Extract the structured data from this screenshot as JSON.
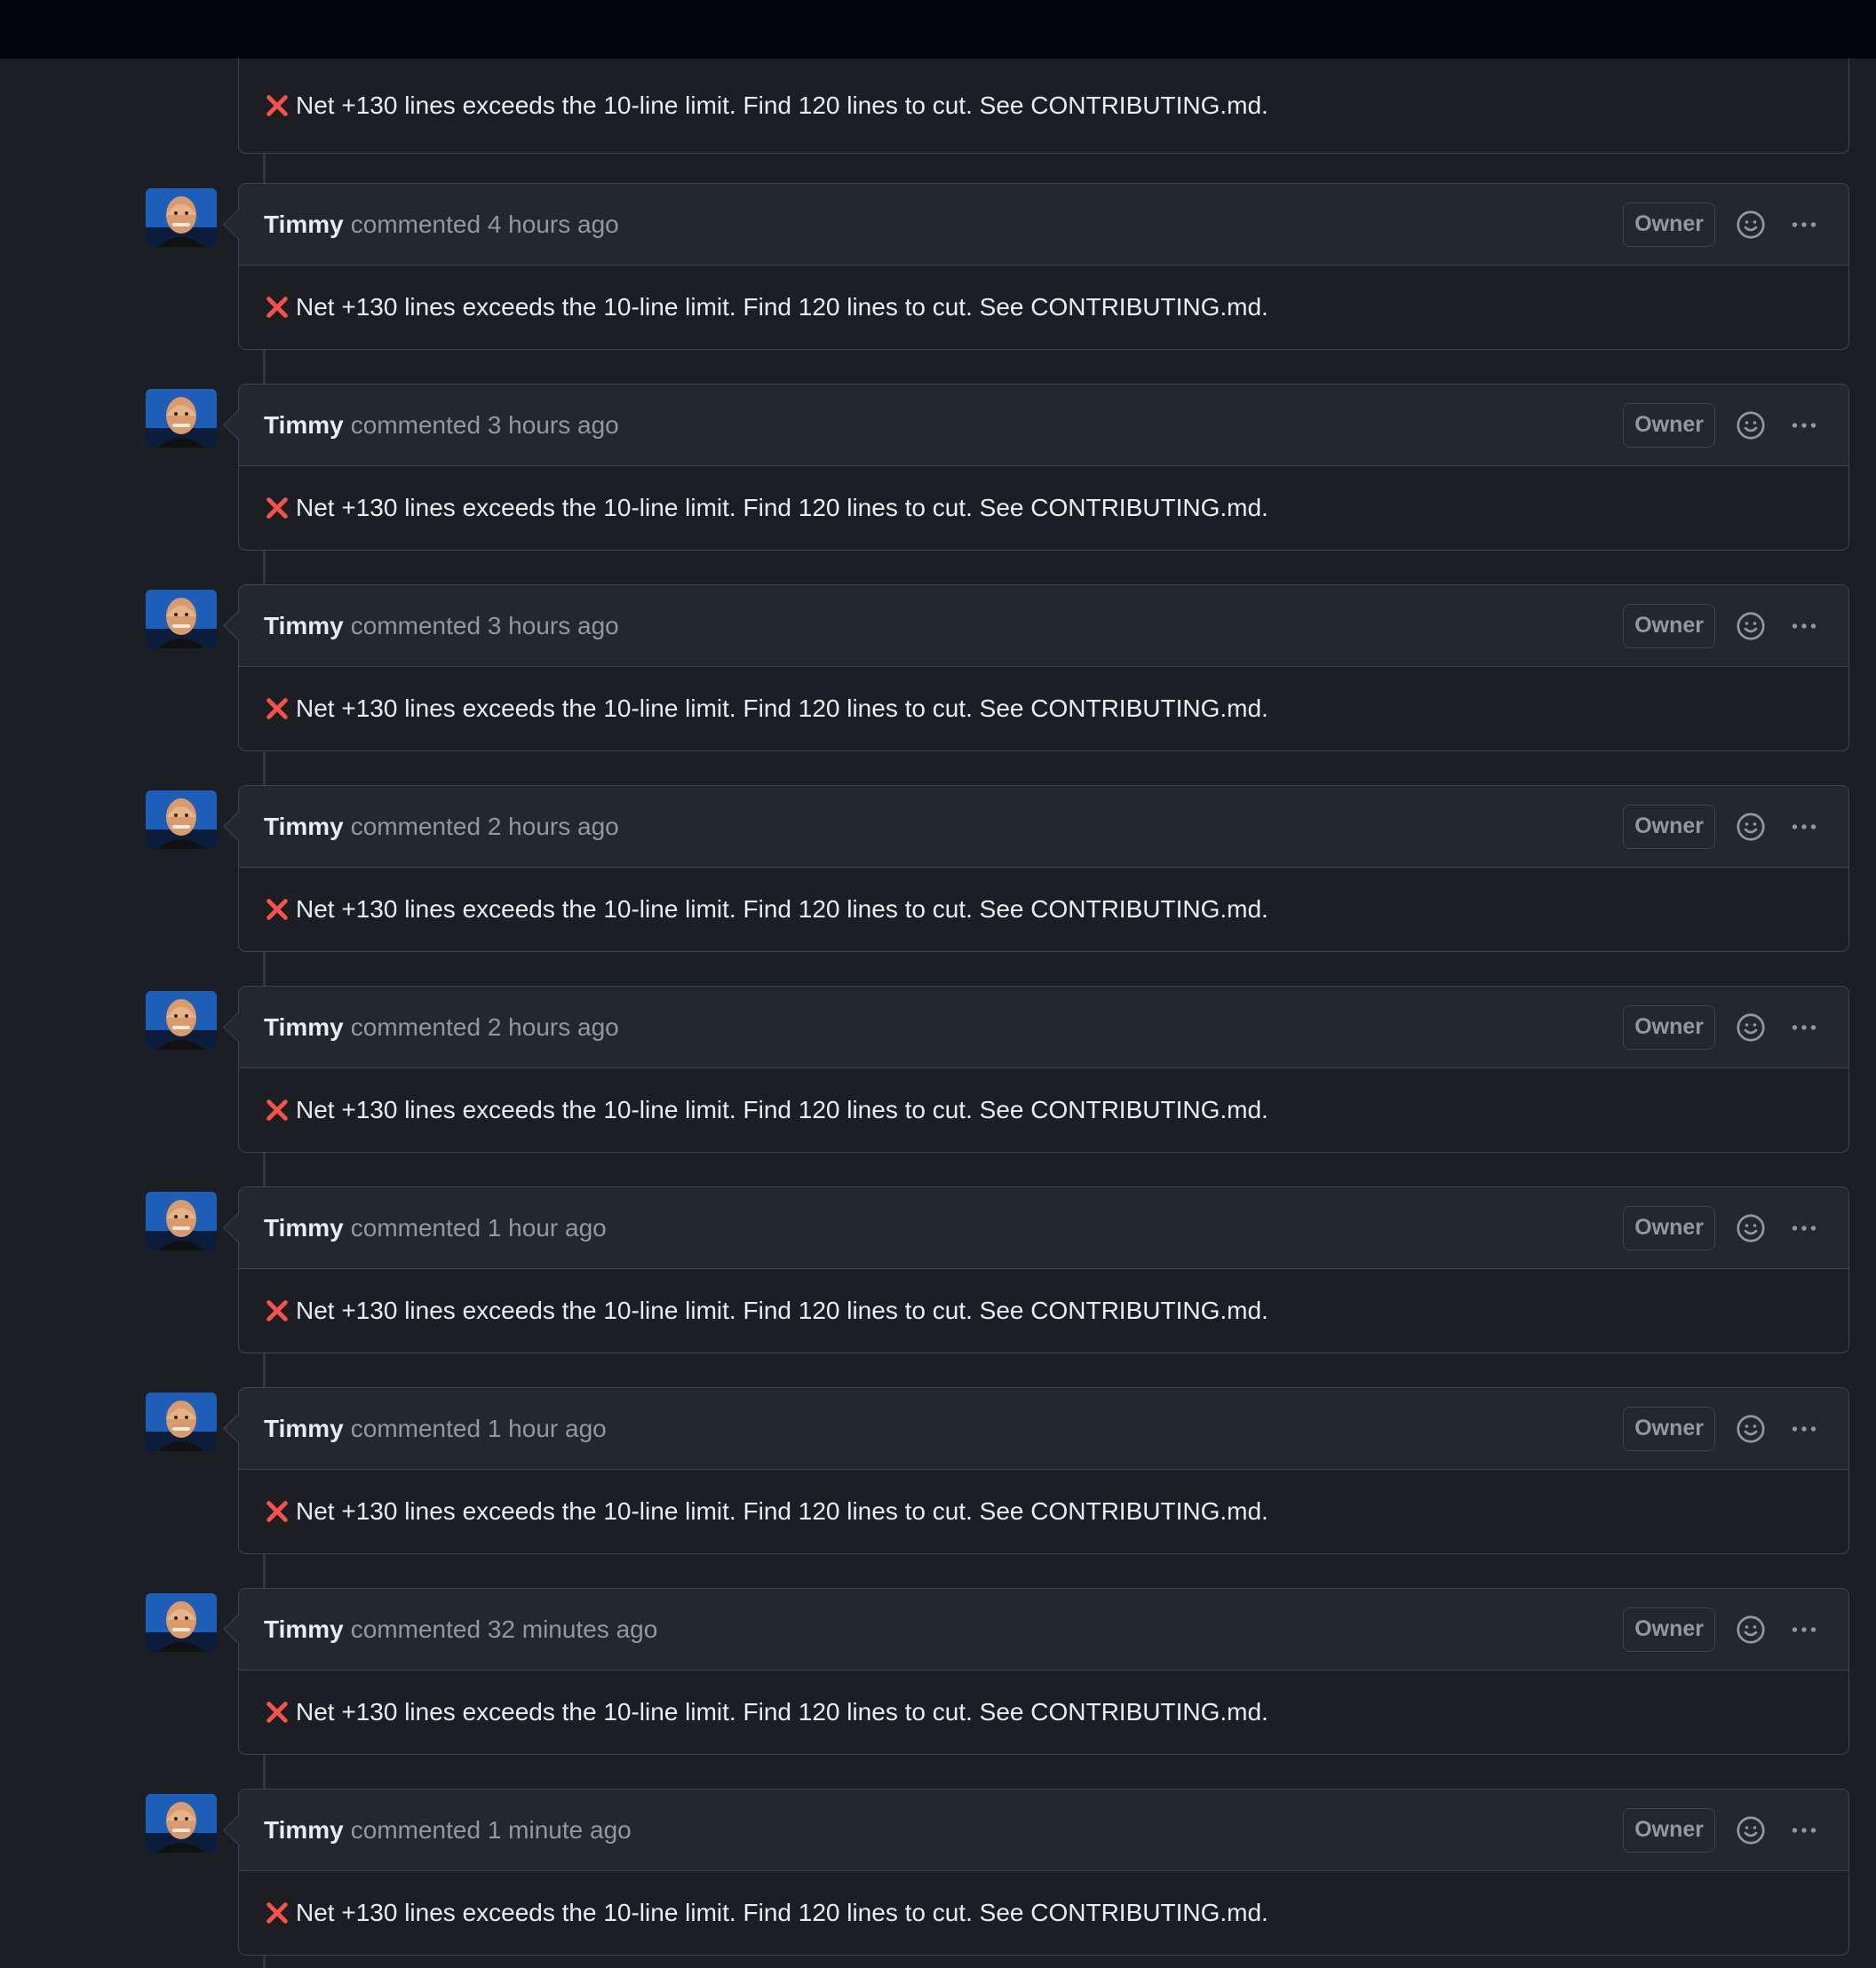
{
  "comments": [
    {
      "author": "",
      "verb": "",
      "time": "",
      "badge": "",
      "body": "Net +130 lines exceeds the 10-line limit. Find 120 lines to cut. See CONTRIBUTING.md."
    },
    {
      "author": "Timmy",
      "verb": "commented",
      "time": "4 hours ago",
      "badge": "Owner",
      "body": "Net +130 lines exceeds the 10-line limit. Find 120 lines to cut. See CONTRIBUTING.md."
    },
    {
      "author": "Timmy",
      "verb": "commented",
      "time": "3 hours ago",
      "badge": "Owner",
      "body": "Net +130 lines exceeds the 10-line limit. Find 120 lines to cut. See CONTRIBUTING.md."
    },
    {
      "author": "Timmy",
      "verb": "commented",
      "time": "3 hours ago",
      "badge": "Owner",
      "body": "Net +130 lines exceeds the 10-line limit. Find 120 lines to cut. See CONTRIBUTING.md."
    },
    {
      "author": "Timmy",
      "verb": "commented",
      "time": "2 hours ago",
      "badge": "Owner",
      "body": "Net +130 lines exceeds the 10-line limit. Find 120 lines to cut. See CONTRIBUTING.md."
    },
    {
      "author": "Timmy",
      "verb": "commented",
      "time": "2 hours ago",
      "badge": "Owner",
      "body": "Net +130 lines exceeds the 10-line limit. Find 120 lines to cut. See CONTRIBUTING.md."
    },
    {
      "author": "Timmy",
      "verb": "commented",
      "time": "1 hour ago",
      "badge": "Owner",
      "body": "Net +130 lines exceeds the 10-line limit. Find 120 lines to cut. See CONTRIBUTING.md."
    },
    {
      "author": "Timmy",
      "verb": "commented",
      "time": "1 hour ago",
      "badge": "Owner",
      "body": "Net +130 lines exceeds the 10-line limit. Find 120 lines to cut. See CONTRIBUTING.md."
    },
    {
      "author": "Timmy",
      "verb": "commented",
      "time": "32 minutes ago",
      "badge": "Owner",
      "body": "Net +130 lines exceeds the 10-line limit. Find 120 lines to cut. See CONTRIBUTING.md."
    },
    {
      "author": "Timmy",
      "verb": "commented",
      "time": "1 minute ago",
      "badge": "Owner",
      "body": "Net +130 lines exceeds the 10-line limit. Find 120 lines to cut. See CONTRIBUTING.md."
    }
  ],
  "icons": {
    "status": "x-icon",
    "reaction": "smiley-icon",
    "menu": "kebab-horizontal-icon"
  },
  "colors": {
    "page_bg": "#1b1f24",
    "header_bg": "#212830",
    "border": "#3d444d",
    "error_red": "#f85149",
    "muted_text": "#9198a1"
  }
}
